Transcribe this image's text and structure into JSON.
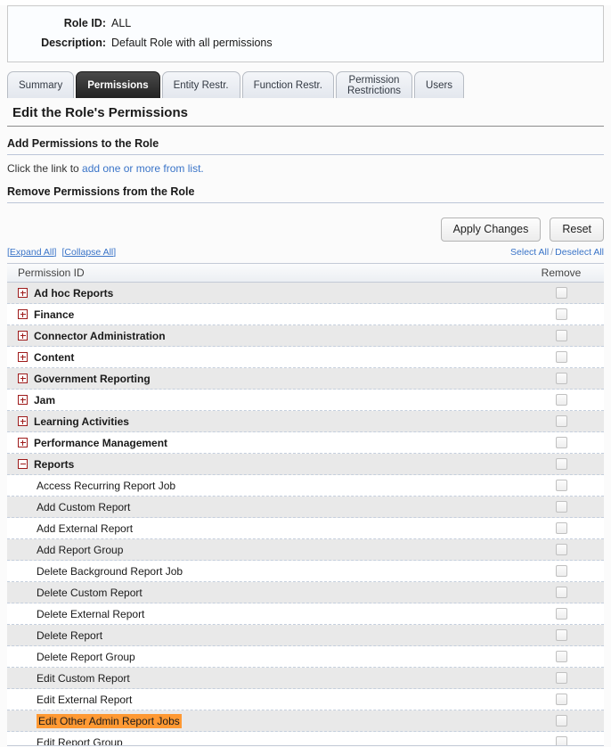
{
  "role_info": {
    "role_id_label": "Role ID:",
    "role_id_value": "ALL",
    "description_label": "Description:",
    "description_value": "Default Role with all permissions"
  },
  "tabs": [
    {
      "label": "Summary",
      "active": false
    },
    {
      "label": "Permissions",
      "active": true
    },
    {
      "label": "Entity Restr.",
      "active": false
    },
    {
      "label": "Function Restr.",
      "active": false
    },
    {
      "label": "Permission\nRestrictions",
      "active": false
    },
    {
      "label": "Users",
      "active": false
    }
  ],
  "page_title": "Edit the Role's Permissions",
  "add_section": {
    "heading": "Add Permissions to the Role",
    "text_prefix": "Click the link to ",
    "link_text": "add one or more from list.",
    "link_color": "#3a74c8"
  },
  "remove_section": {
    "heading": "Remove Permissions from the Role"
  },
  "buttons": {
    "apply_label": "Apply Changes",
    "reset_label": "Reset"
  },
  "utility_links": {
    "expand_all": "Expand All",
    "collapse_all": "Collapse All",
    "bracket_open": "[",
    "bracket_close": "]",
    "select_all": "Select All",
    "separator": "/",
    "deselect_all": "Deselect All"
  },
  "table": {
    "col_permission_id": "Permission ID",
    "col_remove": "Remove",
    "highlight_color": "#ff9933",
    "rows": [
      {
        "label": "Ad hoc Reports",
        "type": "group",
        "icon": "expand-plus-icon",
        "highlight": false
      },
      {
        "label": "Finance",
        "type": "group",
        "icon": "expand-plus-icon",
        "highlight": false
      },
      {
        "label": "Connector Administration",
        "type": "group",
        "icon": "expand-plus-icon",
        "highlight": false
      },
      {
        "label": "Content",
        "type": "group",
        "icon": "expand-plus-icon",
        "highlight": false
      },
      {
        "label": "Government Reporting",
        "type": "group",
        "icon": "expand-plus-icon",
        "highlight": false
      },
      {
        "label": "Jam",
        "type": "group",
        "icon": "expand-plus-icon",
        "highlight": false
      },
      {
        "label": "Learning Activities",
        "type": "group",
        "icon": "expand-plus-icon",
        "highlight": false
      },
      {
        "label": "Performance Management",
        "type": "group",
        "icon": "expand-plus-icon",
        "highlight": false
      },
      {
        "label": "Reports",
        "type": "group",
        "icon": "collapse-minus-icon",
        "highlight": false
      },
      {
        "label": "Access Recurring Report Job",
        "type": "child",
        "icon": "",
        "highlight": false
      },
      {
        "label": "Add Custom Report",
        "type": "child",
        "icon": "",
        "highlight": false
      },
      {
        "label": "Add External Report",
        "type": "child",
        "icon": "",
        "highlight": false
      },
      {
        "label": "Add Report Group",
        "type": "child",
        "icon": "",
        "highlight": false
      },
      {
        "label": "Delete Background Report Job",
        "type": "child",
        "icon": "",
        "highlight": false
      },
      {
        "label": "Delete Custom Report",
        "type": "child",
        "icon": "",
        "highlight": false
      },
      {
        "label": "Delete External Report",
        "type": "child",
        "icon": "",
        "highlight": false
      },
      {
        "label": "Delete Report",
        "type": "child",
        "icon": "",
        "highlight": false
      },
      {
        "label": "Delete Report Group",
        "type": "child",
        "icon": "",
        "highlight": false
      },
      {
        "label": "Edit Custom Report",
        "type": "child",
        "icon": "",
        "highlight": false
      },
      {
        "label": "Edit External Report",
        "type": "child",
        "icon": "",
        "highlight": false
      },
      {
        "label": "Edit Other Admin Report Jobs",
        "type": "child",
        "icon": "",
        "highlight": true
      },
      {
        "label": "Edit Report Group",
        "type": "child",
        "icon": "",
        "highlight": false
      }
    ]
  }
}
